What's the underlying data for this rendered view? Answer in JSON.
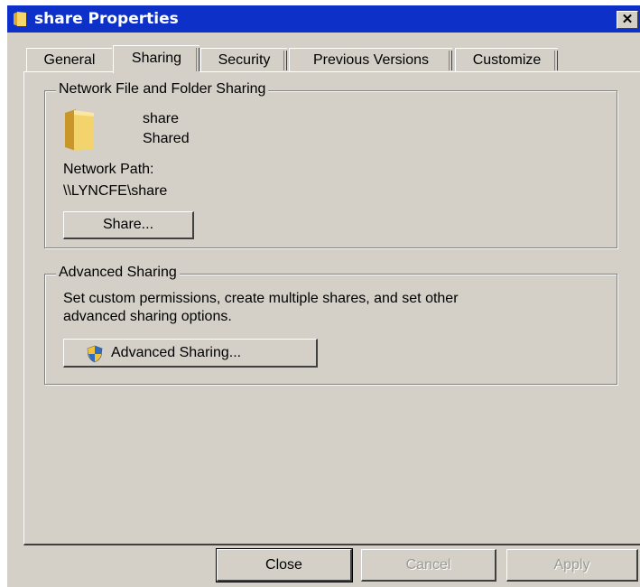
{
  "window": {
    "title": "share Properties",
    "close_glyph": "✕"
  },
  "tabs": [
    {
      "label": "General",
      "active": false
    },
    {
      "label": "Sharing",
      "active": true
    },
    {
      "label": "Security",
      "active": false
    },
    {
      "label": "Previous Versions",
      "active": false
    },
    {
      "label": "Customize",
      "active": false
    }
  ],
  "network_sharing": {
    "group_label": "Network File and Folder Sharing",
    "folder_name": "share",
    "folder_status": "Shared",
    "path_label": "Network Path:",
    "path_value": "\\\\LYNCFE\\share",
    "share_button": "Share..."
  },
  "advanced_sharing": {
    "group_label": "Advanced Sharing",
    "description_line1": "Set custom permissions, create multiple shares, and set other",
    "description_line2": "advanced sharing options.",
    "button_label": "Advanced Sharing...",
    "button_icon": "uac-shield-icon"
  },
  "footer": {
    "close_label": "Close",
    "cancel_label": "Cancel",
    "apply_label": "Apply"
  },
  "colors": {
    "titlebar": "#0d31c8",
    "face": "#d4d0c8",
    "folder": "#f3d36b"
  }
}
